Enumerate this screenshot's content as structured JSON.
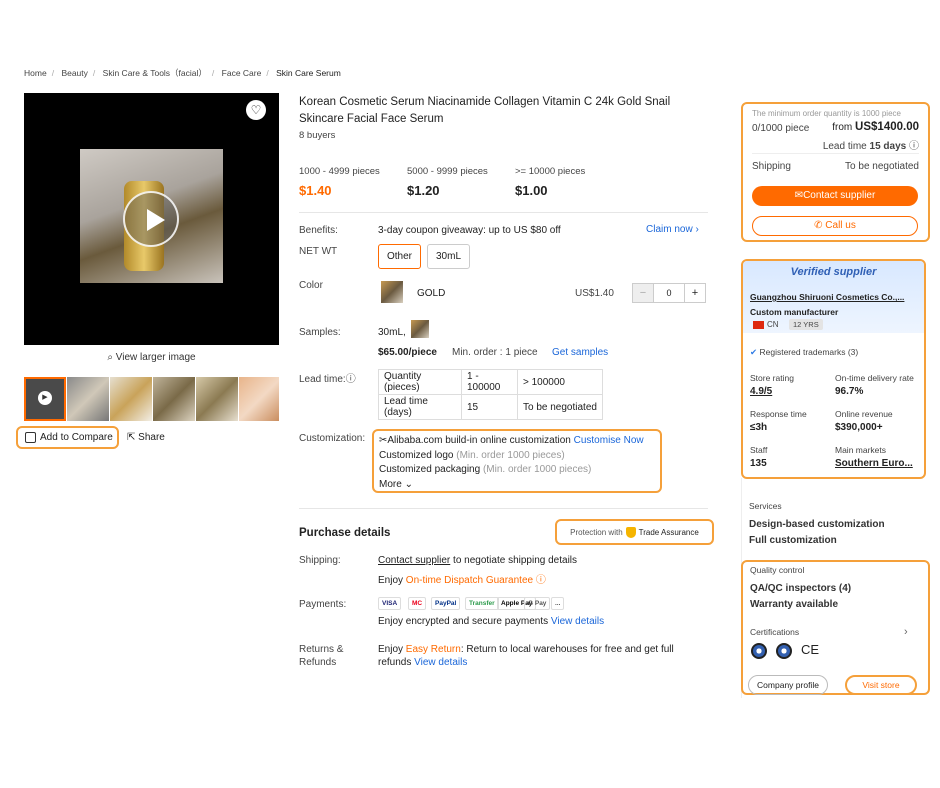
{
  "breadcrumb": [
    "Home",
    "Beauty",
    "Skin Care & Tools（facial）",
    "Face Care",
    "Skin Care Serum"
  ],
  "gallery": {
    "view_larger": "View larger image",
    "add_compare": "Add to Compare",
    "share": "Share"
  },
  "product": {
    "title": "Korean Cosmetic Serum Niacinamide Collagen Vitamin C 24k Gold Snail Skincare Facial Face Serum",
    "buyers": "8 buyers",
    "tiers": [
      {
        "range": "1000 - 4999 pieces",
        "price": "$1.40"
      },
      {
        "range": "5000 - 9999 pieces",
        "price": "$1.20"
      },
      {
        "range": ">= 10000 pieces",
        "price": "$1.00"
      }
    ],
    "benefits_label": "Benefits:",
    "benefits_text": "3-day coupon giveaway: up to US $80 off",
    "claim_now": "Claim now",
    "netwt_label": "NET WT",
    "netwt_options": [
      "Other",
      "30mL"
    ],
    "color_label": "Color",
    "color_name": "GOLD",
    "color_price": "US$1.40",
    "color_qty": "0",
    "samples_label": "Samples:",
    "samples_size": "30mL,",
    "samples_price": "$65.00/piece",
    "samples_min": "Min. order : 1 piece",
    "get_samples": "Get samples",
    "leadtime_label": "Lead time:",
    "leadtime_table": {
      "row1": [
        "Quantity (pieces)",
        "1 - 100000",
        "> 100000"
      ],
      "row2": [
        "Lead time (days)",
        "15",
        "To be negotiated"
      ]
    },
    "custom_label": "Customization:",
    "custom_title": "Alibaba.com build-in online customization",
    "customise_now": "Customise Now",
    "custom_logo": "Customized logo",
    "custom_logo_min": "(Min. order 1000 pieces)",
    "custom_pack": "Customized packaging",
    "custom_pack_min": "(Min. order 1000 pieces)",
    "more": "More"
  },
  "purchase": {
    "heading": "Purchase details",
    "protection": "Protection with",
    "trade_assurance": "Trade Assurance",
    "shipping_label": "Shipping:",
    "contact_supplier_link": "Contact supplier",
    "shipping_text": " to negotiate shipping details",
    "enjoy": "Enjoy ",
    "dispatch": "On-time Dispatch Guarantee",
    "payments_label": "Payments:",
    "pay_methods": [
      "VISA",
      "MC",
      "PayPal",
      "Transfer",
      "Apple Pay",
      "G Pay",
      "..."
    ],
    "payments_text": "Enjoy encrypted and secure payments ",
    "view_details": "View details",
    "returns_label": "Returns & Refunds",
    "easy_return": "Easy Return",
    "returns_text": ": Return to local warehouses for free and get full refunds "
  },
  "order_card": {
    "min_order": "The minimum order quantity is 1000 piece",
    "progress": "0/1000 piece",
    "from": "from ",
    "from_price": "US$1400.00",
    "lead_time": "Lead time ",
    "lead_days": "15 days",
    "shipping": "Shipping",
    "shipping_val": "To be negotiated",
    "contact": "Contact supplier",
    "call": "Call us"
  },
  "supplier": {
    "verified": "Verified supplier",
    "name": "Guangzhou Shiruoni Cosmetics Co.,...",
    "type": "Custom manufacturer",
    "country": "CN",
    "years": "12 YRS",
    "trademarks": "Registered trademarks (3)",
    "stats": [
      {
        "k": "Store rating",
        "v": "4.9/5"
      },
      {
        "k": "On-time delivery rate",
        "v": "96.7%"
      },
      {
        "k": "Response time",
        "v": "≤3h"
      },
      {
        "k": "Online revenue",
        "v": "$390,000+"
      },
      {
        "k": "Staff",
        "v": "135"
      },
      {
        "k": "Main markets",
        "v": "Southern Euro..."
      }
    ],
    "services": "Services",
    "service1": "Design-based customization",
    "service2": "Full customization",
    "quality": "Quality control",
    "qa": "QA/QC inspectors (4)",
    "warranty": "Warranty available",
    "certs": "Certifications",
    "ce": "CE",
    "company_profile": "Company profile",
    "visit_store": "Visit store"
  }
}
